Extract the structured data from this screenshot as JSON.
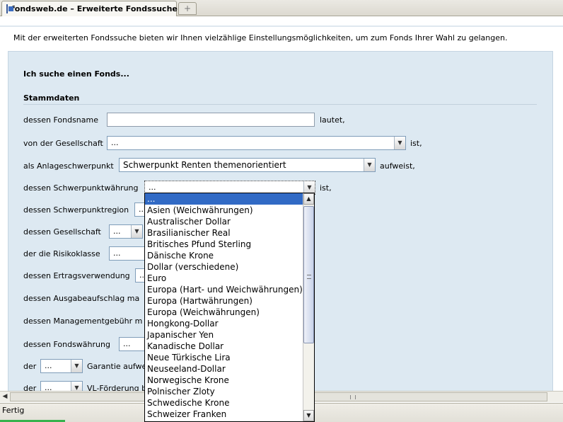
{
  "tab": {
    "title": "fondsweb.de – Erweiterte Fondssuche",
    "new_tab": "+"
  },
  "page": {
    "intro": "Mit der erweiterten Fondssuche bieten wir Ihnen vielzählige Einstellungsmöglichkeiten, um zum Fonds Ihrer Wahl zu gelangen.",
    "heading": "Ich suche einen Fonds...",
    "section": "Stammdaten"
  },
  "form": {
    "fondsname": {
      "label": "dessen Fondsname",
      "suffix": "lautet,"
    },
    "gesellschaft": {
      "label": "von der Gesellschaft",
      "value": "...",
      "suffix": "ist,"
    },
    "anlageschwerpunkt": {
      "label": "als Anlageschwerpunkt",
      "value": "Schwerpunkt Renten themenorientiert",
      "suffix": "aufweist,"
    },
    "schwerpunktwaehrung": {
      "label": "dessen Schwerpunktwährung",
      "value": "...",
      "suffix": "ist,"
    },
    "schwerpunktregion": {
      "label": "dessen Schwerpunktregion",
      "value": "..."
    },
    "gesellschaft2": {
      "label": "dessen Gesellschaft",
      "value": "..."
    },
    "risikoklasse": {
      "label": "der die Risikoklasse",
      "value": "..."
    },
    "ertragsverwendung": {
      "label": "dessen Ertragsverwendung",
      "value": "..."
    },
    "ausgabeaufschlag": {
      "label": "dessen Ausgabeaufschlag ma"
    },
    "managementgebuehr": {
      "label": "dessen Managementgebühr m"
    },
    "fondswaehrung": {
      "label": "dessen Fondswährung",
      "value": "..."
    },
    "garantie": {
      "prefix": "der",
      "value": "...",
      "label": "Garantie aufwe"
    },
    "vl": {
      "prefix": "der",
      "value": "...",
      "label": "VL-Förderung b"
    }
  },
  "dropdown": {
    "selected_index": 0,
    "options": [
      "...",
      "Asien (Weichwährungen)",
      "Australischer Dollar",
      "Brasilianischer Real",
      "Britisches Pfund Sterling",
      "Dänische Krone",
      "Dollar (verschiedene)",
      "Euro",
      "Europa (Hart- und Weichwährungen)",
      "Europa (Hartwährungen)",
      "Europa (Weichwährungen)",
      "Hongkong-Dollar",
      "Japanischer Yen",
      "Kanadische Dollar",
      "Neue Türkische Lira",
      "Neuseeland-Dollar",
      "Norwegische Krone",
      "Polnischer Zloty",
      "Schwedische Krone",
      "Schweizer Franken"
    ]
  },
  "status": {
    "text": "Fertig"
  }
}
